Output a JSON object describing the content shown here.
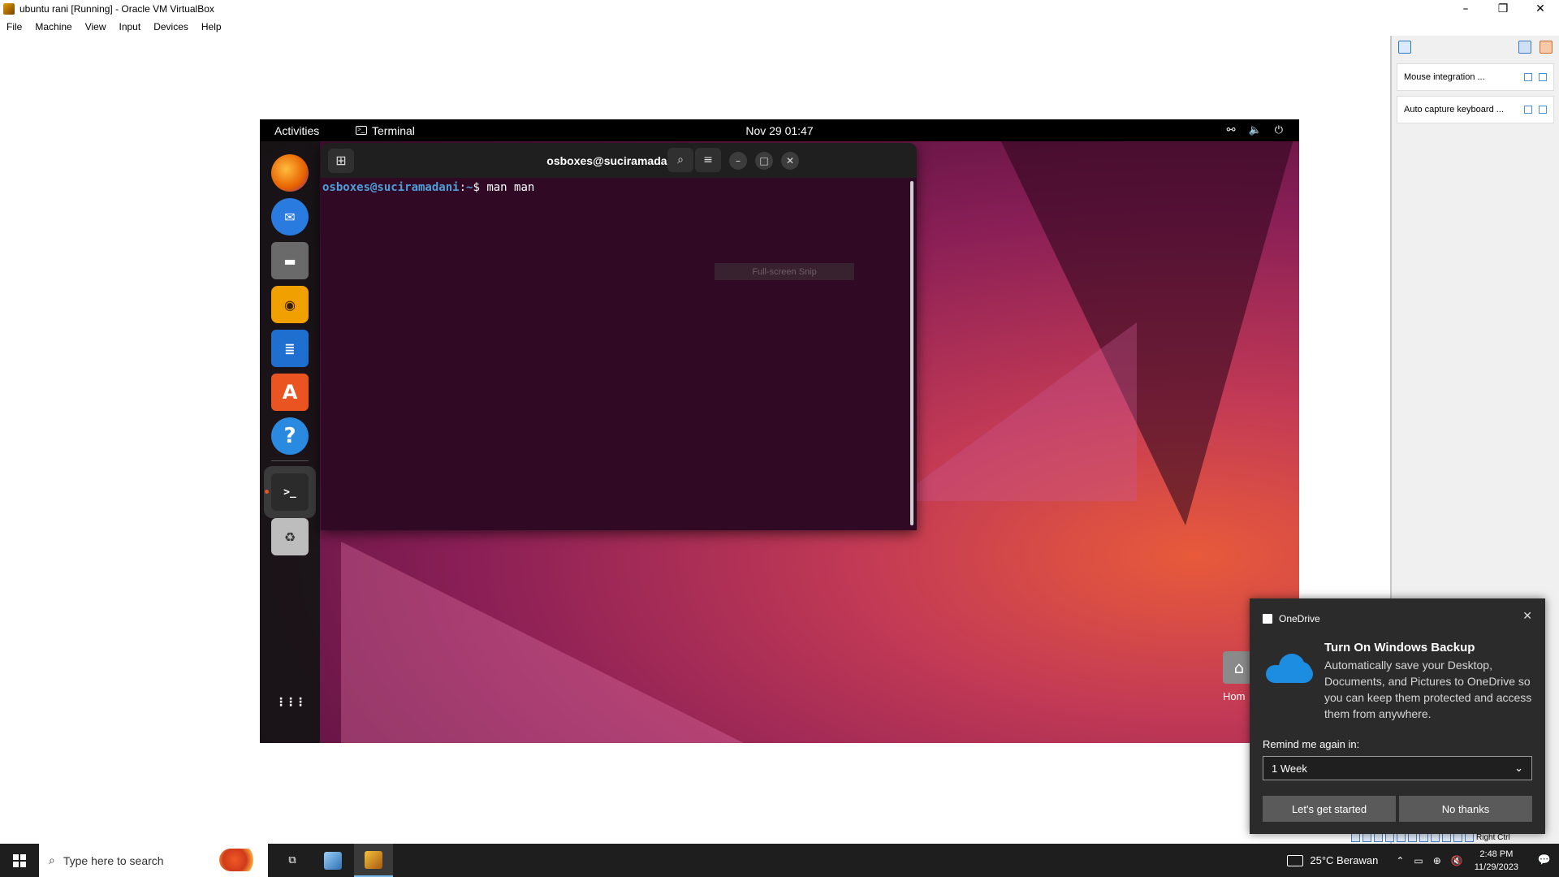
{
  "window": {
    "title": "ubuntu rani [Running] - Oracle VM VirtualBox",
    "minimize": "–",
    "restore": "❐",
    "close": "✕"
  },
  "menubar": [
    "File",
    "Machine",
    "View",
    "Input",
    "Devices",
    "Help"
  ],
  "notification_pane": {
    "items": [
      {
        "label": "Mouse integration ..."
      },
      {
        "label": "Auto capture keyboard ..."
      }
    ]
  },
  "gnome": {
    "activities": "Activities",
    "app_name": "Terminal",
    "clock": "Nov 29  01:47",
    "tray": [
      "⚯",
      "🔈",
      "⏻"
    ]
  },
  "dock": {
    "items": [
      {
        "name": "firefox-icon",
        "glyph": "",
        "color": "#e66000"
      },
      {
        "name": "thunderbird-icon",
        "glyph": "✉",
        "color": "#2a7be0"
      },
      {
        "name": "files-icon",
        "glyph": "▬",
        "color": "#6a6a6a"
      },
      {
        "name": "rhythmbox-icon",
        "glyph": "◉",
        "color": "#f0a000"
      },
      {
        "name": "writer-icon",
        "glyph": "≣",
        "color": "#1f6fd0"
      },
      {
        "name": "app-center-icon",
        "glyph": "A",
        "color": "#e95420"
      },
      {
        "name": "help-icon",
        "glyph": "?",
        "color": "#2a8ae0"
      }
    ],
    "terminal_glyph": ">_",
    "trash_glyph": "♻",
    "show_apps_glyph": "⋮⋮⋮"
  },
  "terminal": {
    "title": "osboxes@suciramadani: ~",
    "new_tab": "⊞",
    "search": "⌕",
    "menu": "≡",
    "minimize": "–",
    "maximize": "□",
    "close": "✕",
    "prompt_user": "osboxes@suciramadani",
    "prompt_sep": ":",
    "prompt_path": "~",
    "prompt_symbol": "$ ",
    "command": "man man"
  },
  "snip_overlay": "Full-screen Snip",
  "desktop": {
    "home_label": "Hom",
    "home_glyph": "⌂"
  },
  "toast": {
    "app": "OneDrive",
    "close": "✕",
    "title": "Turn On Windows Backup",
    "body": "Automatically save your Desktop, Documents, and Pictures to OneDrive so you can keep them protected and access them from anywhere.",
    "remind_label": "Remind me again in:",
    "remind_value": "1 Week",
    "chevron": "⌄",
    "primary_button": "Let's get started",
    "secondary_button": "No thanks"
  },
  "vbox_status": {
    "host_key": "Right Ctrl"
  },
  "taskbar": {
    "search_placeholder": "Type here to search",
    "search_glyph": "⌕",
    "task_view_glyph": "⧉",
    "weather": "25°C  Berawan",
    "tray_icons": [
      "⌃",
      "▭",
      "⊕",
      "🔇"
    ],
    "time": "2:48 PM",
    "date": "11/29/2023",
    "notification_glyph": "💬"
  }
}
